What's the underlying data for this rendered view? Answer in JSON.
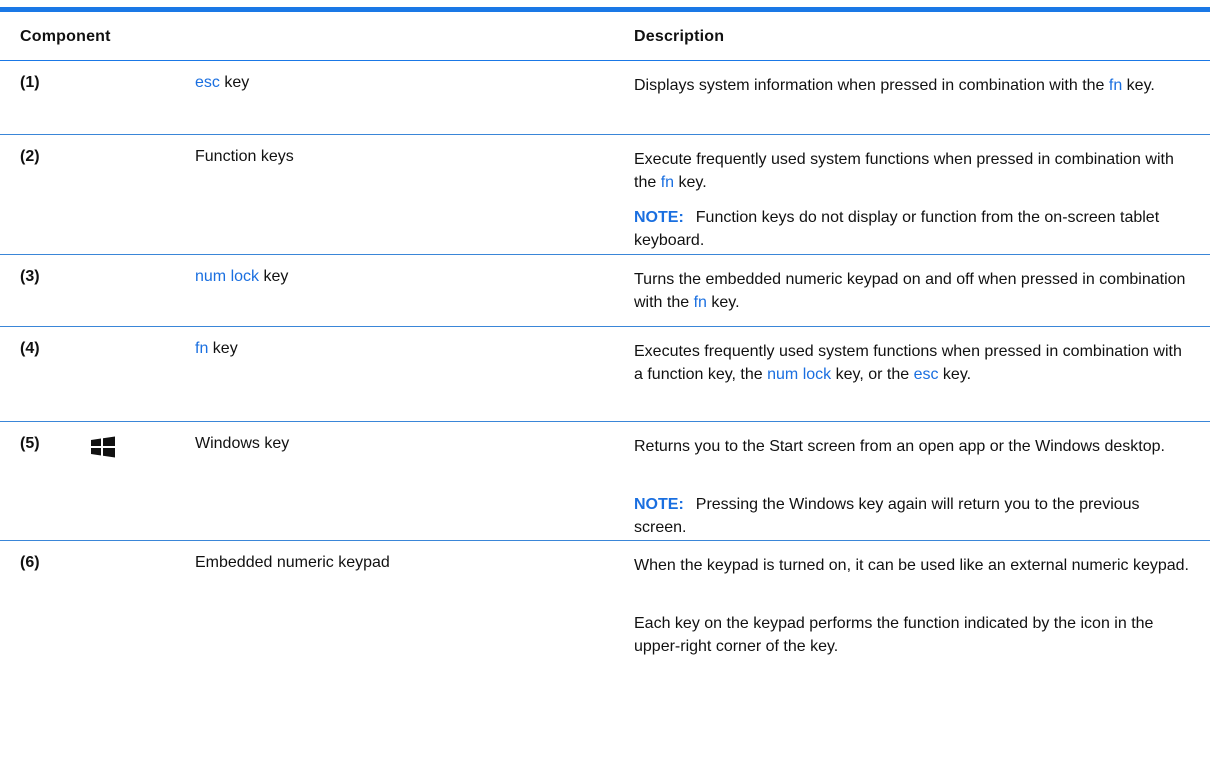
{
  "headers": {
    "component": "Component",
    "description": "Description"
  },
  "rows": [
    {
      "number": "(1)",
      "name_kw": "esc",
      "name_rest": " key",
      "desc": {
        "p1_a": "Displays system information when pressed in combination with the ",
        "p1_kw": "fn",
        "p1_b": " key."
      }
    },
    {
      "number": "(2)",
      "name": "Function keys",
      "desc": {
        "p1": "Execute frequently used system functions when pressed in combination with the ",
        "p1_kw": "fn",
        "p1_b": " key.",
        "note_label": "NOTE:",
        "note_text": "Function keys do not display or function from the on-screen tablet keyboard."
      }
    },
    {
      "number": "(3)",
      "name_kw": "num lock",
      "name_rest": " key",
      "desc": {
        "p1_a": "Turns the embedded numeric keypad on and off when pressed in combination with the ",
        "p1_kw": "fn",
        "p1_b": " key."
      }
    },
    {
      "number": "(4)",
      "name_kw": "fn",
      "name_rest": " key",
      "desc": {
        "p1_a": "Executes frequently used system functions when pressed in combination with a function key, the ",
        "p1_kw1": "num lock",
        "p1_mid": " key, or the ",
        "p1_kw2": "esc",
        "p1_b": " key."
      }
    },
    {
      "number": "(5)",
      "icon": "windows-logo-icon",
      "name": "Windows key",
      "desc": {
        "p1": "Returns you to the Start screen from an open app or the Windows desktop.",
        "note_label": "NOTE:",
        "note_text": "Pressing the Windows key again will return you to the previous screen."
      }
    },
    {
      "number": "(6)",
      "name": "Embedded numeric keypad",
      "desc": {
        "p1": "When the keypad is turned on, it can be used like an external numeric keypad.",
        "p2": "Each key on the keypad performs the function indicated by the icon in the upper-right corner of the key."
      }
    }
  ],
  "colors": {
    "accent": "#1a78e6",
    "keyword": "#1a6fe0",
    "text": "#111111"
  }
}
